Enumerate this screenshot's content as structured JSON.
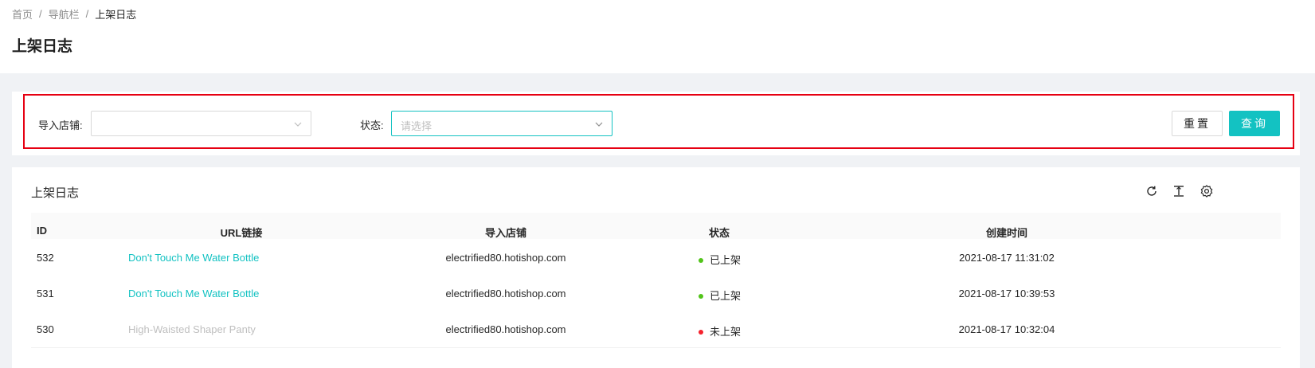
{
  "breadcrumb": {
    "items": [
      "首页",
      "导航栏",
      "上架日志"
    ],
    "separator": "/"
  },
  "page_title": "上架日志",
  "filters": {
    "store_label": "导入店铺:",
    "store_value": "",
    "status_label": "状态:",
    "status_placeholder": "请选择",
    "reset_label": "重置",
    "query_label": "查询"
  },
  "table": {
    "title": "上架日志",
    "toolbar_icons": [
      "refresh-icon",
      "column-height-icon",
      "setting-icon"
    ],
    "columns": [
      "ID",
      "URL链接",
      "导入店铺",
      "状态",
      "创建时间"
    ],
    "rows": [
      {
        "id": "532",
        "url": "Don't Touch Me Water Bottle",
        "store": "electrified80.hotishop.com",
        "status": "已上架",
        "status_color": "#52c41a",
        "link_disabled": false,
        "created": "2021-08-17 11:31:02"
      },
      {
        "id": "531",
        "url": "Don't Touch Me Water Bottle",
        "store": "electrified80.hotishop.com",
        "status": "已上架",
        "status_color": "#52c41a",
        "link_disabled": false,
        "created": "2021-08-17 10:39:53"
      },
      {
        "id": "530",
        "url": "High-Waisted Shaper Panty",
        "store": "electrified80.hotishop.com",
        "status": "未上架",
        "status_color": "#f5222d",
        "link_disabled": true,
        "created": "2021-08-17 10:32:04"
      }
    ]
  },
  "colors": {
    "accent": "#13c2c2",
    "highlight_border": "#e60012",
    "success": "#52c41a",
    "error": "#f5222d"
  }
}
